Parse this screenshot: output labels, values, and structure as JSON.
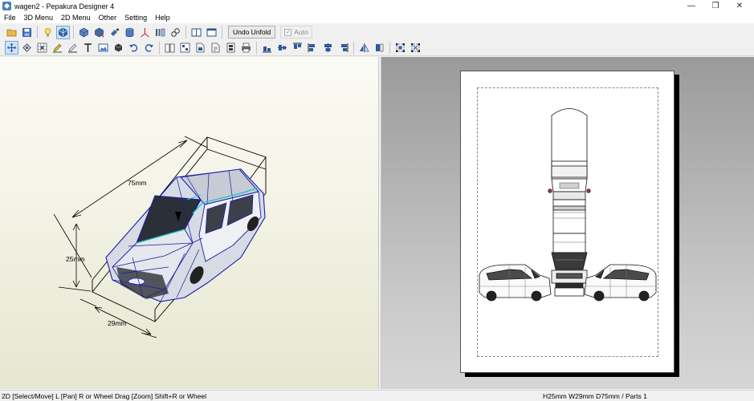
{
  "window": {
    "title": "wagen2 - Pepakura Designer 4",
    "controls": {
      "minimize": "—",
      "restore": "❐",
      "close": "✕"
    }
  },
  "menu": [
    "File",
    "3D Menu",
    "2D Menu",
    "Other",
    "Setting",
    "Help"
  ],
  "toolbar1": {
    "icons": [
      "open-icon",
      "save-icon",
      "light-icon",
      "texture-icon",
      "cube-icon",
      "cube-edit-icon",
      "paint-icon",
      "cylinder-icon",
      "axis-icon",
      "flap-icon",
      "link-icon",
      "layout-icon",
      "window-icon"
    ],
    "undo_unfold_label": "Undo Unfold",
    "auto_label": "Auto",
    "auto_checked": true
  },
  "toolbar2": {
    "icons": [
      "select-move-icon",
      "rotate-icon",
      "grid-icon",
      "pencil-icon",
      "pencil-2-icon",
      "text-icon",
      "image-icon",
      "cube-small-icon",
      "undo-icon",
      "redo-icon",
      "book-icon",
      "print-preview-icon",
      "page-icon",
      "copy-icon",
      "pages-icon",
      "printer-icon",
      "align-left-icon",
      "align-center-icon",
      "align-right-icon",
      "align-top-icon",
      "align-middle-icon",
      "align-bottom-icon",
      "flip-h-icon",
      "flip-v-icon",
      "group-icon",
      "ungroup-icon"
    ]
  },
  "view3d": {
    "dimensions": {
      "length": "75mm",
      "height": "25mm",
      "width": "29mm"
    },
    "colors": {
      "wire": "#1a1aaa",
      "seam": "#19c6c6",
      "box": "#000000"
    }
  },
  "view2d": {
    "paper": "A4"
  },
  "status": {
    "left": "2D [Select/Move] L [Pan] R or Wheel Drag [Zoom] Shift+R or Wheel",
    "right": "H25mm W29mm D75mm / Parts 1"
  }
}
